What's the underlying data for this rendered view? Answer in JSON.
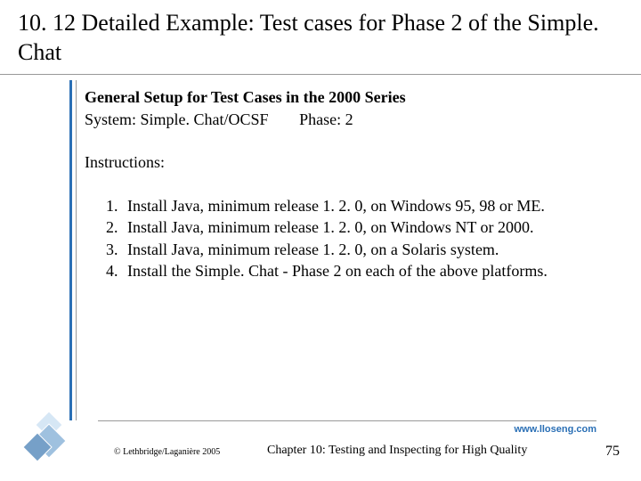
{
  "title": "10. 12 Detailed Example: Test cases for Phase 2 of the Simple. Chat",
  "setup": {
    "heading": "General Setup for Test Cases in the 2000 Series",
    "system_label": "System",
    "system_value": "Simple. Chat/OCSF",
    "phase_label": "Phase",
    "phase_value": "2"
  },
  "instructions_label": "Instructions",
  "instructions": [
    "Install Java, minimum release 1. 2. 0, on Windows 95, 98 or ME.",
    "Install Java, minimum release 1. 2. 0, on Windows NT or 2000.",
    "Install Java, minimum release 1. 2. 0, on a Solaris system.",
    "Install the Simple. Chat - Phase 2 on each of the above platforms."
  ],
  "footer": {
    "url": "www.lloseng.com",
    "copyright": "© Lethbridge/Laganière 2005",
    "chapter": "Chapter 10: Testing and Inspecting for High Quality",
    "page": "75"
  }
}
